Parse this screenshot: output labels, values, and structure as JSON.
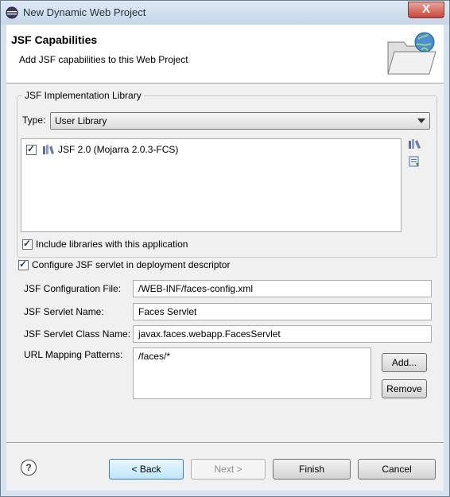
{
  "window": {
    "title": "New Dynamic Web Project",
    "close_label": "X"
  },
  "banner": {
    "title": "JSF Capabilities",
    "description": "Add JSF capabilities to this Web Project"
  },
  "library_group": {
    "title": "JSF Implementation Library",
    "type_label": "Type:",
    "type_value": "User Library",
    "libraries": [
      {
        "label": "JSF 2.0 (Mojarra 2.0.3-FCS)",
        "checked": true
      }
    ],
    "include_label": "Include libraries with this application",
    "include_checked": true
  },
  "servlet": {
    "configure_label": "Configure JSF servlet in deployment descriptor",
    "configure_checked": true,
    "config_file_label": "JSF Configuration File:",
    "config_file_value": "/WEB-INF/faces-config.xml",
    "servlet_name_label": "JSF Servlet Name:",
    "servlet_name_value": "Faces Servlet",
    "servlet_class_label": "JSF Servlet Class Name:",
    "servlet_class_value": "javax.faces.webapp.FacesServlet",
    "url_patterns_label": "URL Mapping Patterns:",
    "url_patterns": [
      "/faces/*"
    ],
    "add_label": "Add...",
    "remove_label": "Remove"
  },
  "footer": {
    "help_label": "?",
    "back_label": "< Back",
    "next_label": "Next >",
    "finish_label": "Finish",
    "cancel_label": "Cancel"
  }
}
